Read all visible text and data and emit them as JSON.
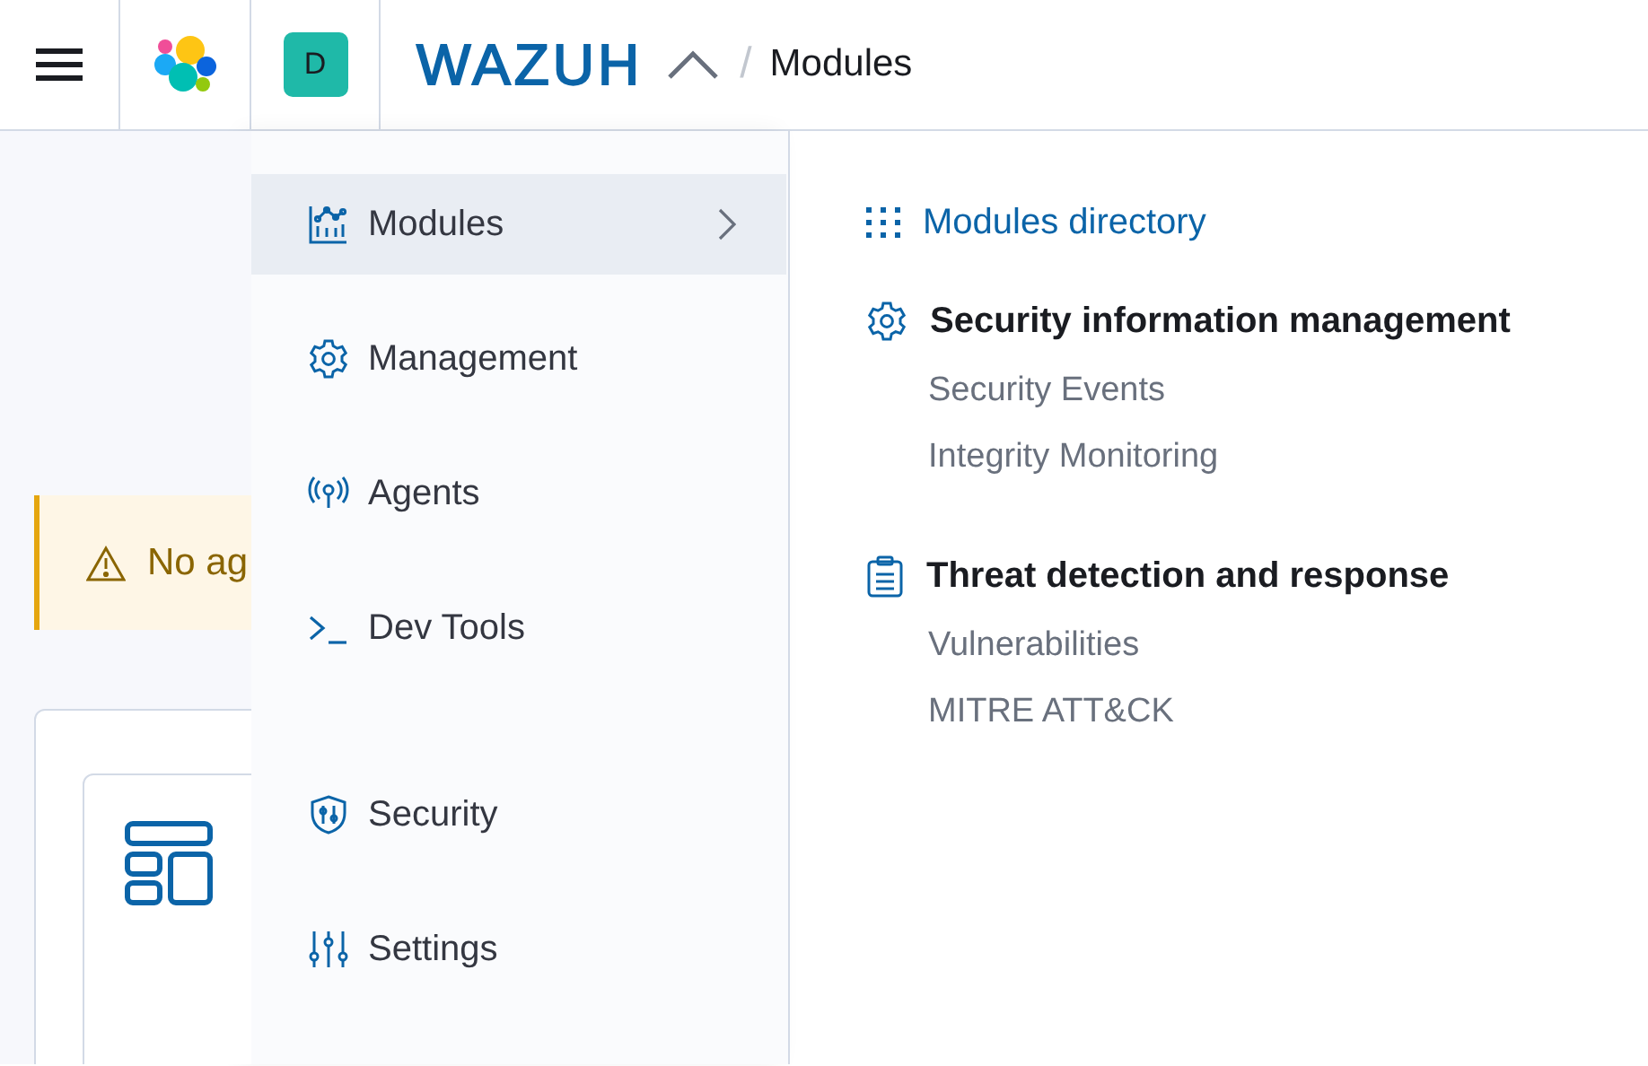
{
  "header": {
    "avatar": "D",
    "brand": "WAZUH",
    "breadcrumb_separator": "/",
    "breadcrumb": "Modules"
  },
  "background_page": {
    "callout": "No ag"
  },
  "menu": {
    "groups": [
      [
        {
          "label": "Modules",
          "selected": true,
          "has_submenu": true
        },
        {
          "label": "Management",
          "selected": false,
          "has_submenu": false
        },
        {
          "label": "Agents",
          "selected": false,
          "has_submenu": false
        },
        {
          "label": "Dev Tools",
          "selected": false,
          "has_submenu": false
        }
      ],
      [
        {
          "label": "Security",
          "selected": false,
          "has_submenu": false
        },
        {
          "label": "Settings",
          "selected": false,
          "has_submenu": false
        }
      ]
    ]
  },
  "submenu": {
    "link": "Modules directory",
    "sections": [
      {
        "title": "Security information management",
        "items": [
          "Security Events",
          "Integrity Monitoring"
        ]
      },
      {
        "title": "Threat detection and response",
        "items": [
          "Vulnerabilities",
          "MITRE ATT&CK"
        ]
      }
    ]
  }
}
